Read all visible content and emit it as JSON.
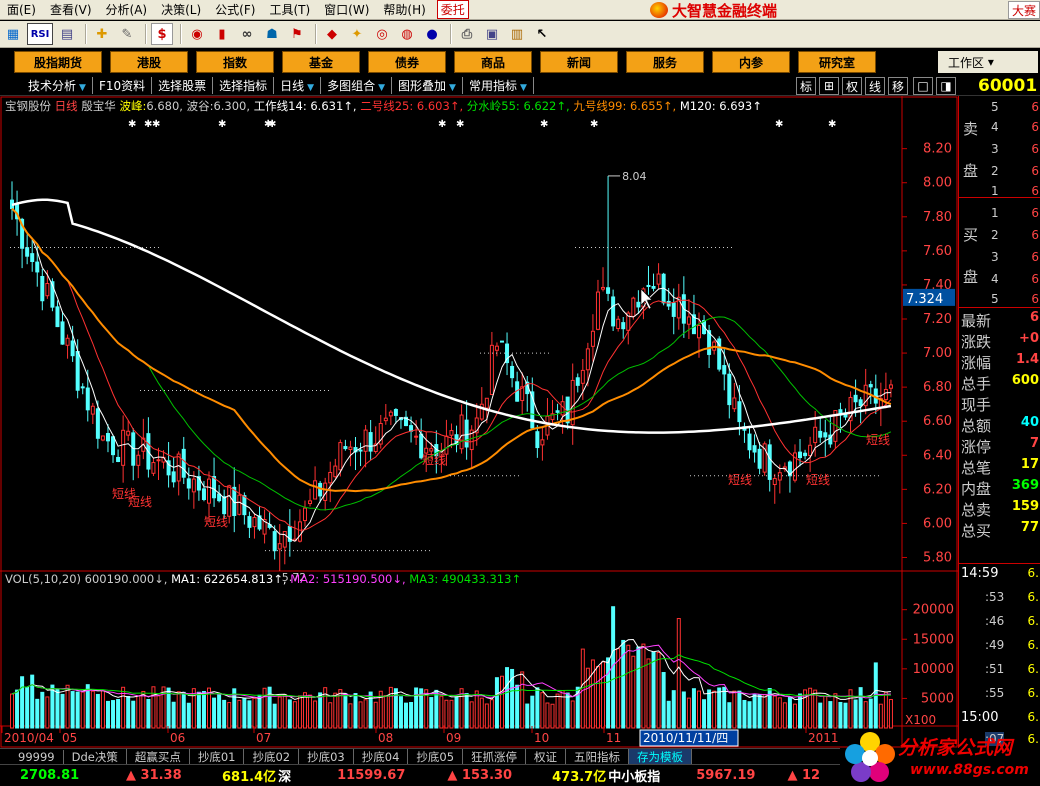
{
  "menu": {
    "items": [
      "面(E)",
      "查看(V)",
      "分析(A)",
      "决策(L)",
      "公式(F)",
      "工具(T)",
      "窗口(W)",
      "帮助(H)"
    ],
    "weituo": "委托",
    "brand": "大智慧金融终端",
    "right_label": "大赛"
  },
  "toolbar": {
    "rsi_label": "RSI"
  },
  "nav": {
    "buttons": [
      "股指期货",
      "港股",
      "指数",
      "基金",
      "债券",
      "商品",
      "新闻",
      "服务",
      "内参",
      "研究室"
    ],
    "workspace": "工作区"
  },
  "tabs": {
    "items": [
      "技术分析",
      "F10资料",
      "选择股票",
      "选择指标",
      "日线",
      "多图组合",
      "图形叠加",
      "常用指标"
    ],
    "right_icons": [
      "标",
      "⊞",
      "权",
      "线",
      "移",
      "□",
      "◨"
    ],
    "stock_code": "60001"
  },
  "info1": {
    "stock_name": "宝钢股份",
    "period": "日线",
    "indicator": "殷宝华",
    "bofeng_label": "波峰:",
    "bofeng": "6.680,",
    "bogu_label": "波谷:",
    "bogu": "6.300,",
    "ma14": "工作线14: 6.631↑,",
    "ma25": "二号线25: 6.603↑,",
    "ma55": "分水岭55: 6.622↑,",
    "ma99": "九号线99: 6.655↑,",
    "ma120": "M120: 6.693↑"
  },
  "info2": {
    "vol_label": "VOL(5,10,20)",
    "vol": "600190.000↓,",
    "ma1": "MA1: 622654.813↑,",
    "ma2": "MA2: 515190.500↓,",
    "ma3": "MA3: 490433.313↑"
  },
  "chart_data": {
    "type": "candlestick",
    "price_axis": [
      "8.20",
      "8.00",
      "7.80",
      "7.60",
      "7.40",
      "7.20",
      "7.00",
      "6.80",
      "6.60",
      "6.40",
      "6.20",
      "6.00",
      "5.80"
    ],
    "price_ylim": [
      5.75,
      8.38
    ],
    "current_price": "7.324",
    "high_label": "8.04",
    "low_label": "5.72",
    "short_labels": [
      "短线",
      "短线",
      "短线",
      "短线",
      "短线",
      "短线",
      "短线"
    ],
    "volume_axis": [
      "20000",
      "15000",
      "10000",
      "5000"
    ],
    "volume_unit": "X100",
    "months": [
      "2010/04",
      "05",
      "06",
      "07",
      "08",
      "09",
      "10",
      "11",
      "2011"
    ],
    "cursor_date": "2010/11/11/四"
  },
  "quote": {
    "sell_label": [
      "卖",
      "盘"
    ],
    "buy_label": [
      "买",
      "盘"
    ],
    "sell_levels": [
      "5",
      "4",
      "3",
      "2",
      "1"
    ],
    "buy_levels": [
      "1",
      "2",
      "3",
      "4",
      "5"
    ],
    "level_values": [
      "6",
      "6",
      "6",
      "6",
      "6"
    ],
    "stats": [
      {
        "label": "最新",
        "value": "6"
      },
      {
        "label": "涨跌",
        "value": "+0"
      },
      {
        "label": "涨幅",
        "value": "1.4"
      },
      {
        "label": "总手",
        "value": "600"
      },
      {
        "label": "现手",
        "value": ""
      },
      {
        "label": "总额",
        "value": "40"
      },
      {
        "label": "涨停",
        "value": "7"
      },
      {
        "label": "总笔",
        "value": "17"
      },
      {
        "label": "内盘",
        "value": "369"
      },
      {
        "label": "总卖",
        "value": "159"
      },
      {
        "label": "总买",
        "value": "77"
      }
    ],
    "ticks": [
      {
        "time": "14:59",
        "price": "6."
      },
      {
        "time": ":53",
        "price": "6."
      },
      {
        "time": ":46",
        "price": "6."
      },
      {
        "time": ":49",
        "price": "6."
      },
      {
        "time": ":51",
        "price": "6."
      },
      {
        "time": ":55",
        "price": "6."
      },
      {
        "time": "15:00",
        "price": "6."
      },
      {
        "time": ":07",
        "price": "6."
      }
    ]
  },
  "bottom_tabs": [
    "99999",
    "Dde决策",
    "超赢买点",
    "抄底01",
    "抄底02",
    "抄底03",
    "抄底04",
    "抄底05",
    "狂抓涨停",
    "权证",
    "五阳指标",
    "存为模板"
  ],
  "status": {
    "sh_index": "2708.81",
    "sh_change": "▲ 31.38",
    "sh_amount": "681.4亿",
    "sz_label": "深",
    "sz_index": "11599.67",
    "sz_change": "▲ 153.30",
    "sz_amount": "473.7亿",
    "sme_label": "中小板指",
    "sme_index": "5967.19",
    "sme_change": "▲ 12"
  },
  "watermark": {
    "title": "分析家公式网",
    "url": "www.88gs.com"
  },
  "colors": {
    "up": "#ff3232",
    "down": "#54ffff",
    "ma14": "#ffffff",
    "ma25": "#ff3232",
    "ma55": "#00c000",
    "ma99": "#ff8c00",
    "ma120": "#ffffff"
  }
}
